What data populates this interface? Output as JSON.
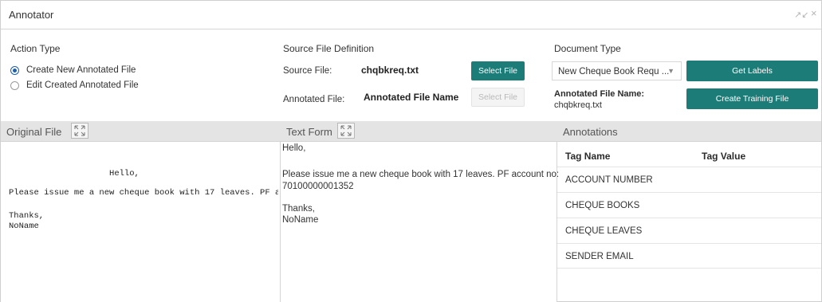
{
  "window": {
    "title": "Annotator",
    "minimize_glyph": "↗↙",
    "close_glyph": "×"
  },
  "action_type": {
    "label": "Action Type",
    "options": [
      {
        "label": "Create New Annotated File",
        "checked": true
      },
      {
        "label": "Edit Created Annotated File",
        "checked": false
      }
    ]
  },
  "source": {
    "label": "Source File Definition",
    "source_file_label": "Source File:",
    "source_file_value": "chqbkreq.txt",
    "select_file_label": "Select File",
    "annotated_file_label": "Annotated File:",
    "annotated_file_value": "Annotated File Name",
    "select_file_disabled_label": "Select File"
  },
  "document_type": {
    "label": "Document Type",
    "selected": "New Cheque Book Requ ...",
    "get_labels": "Get Labels",
    "annotated_name_label": "Annotated File Name:",
    "annotated_name_value": "chqbkreq.txt",
    "create_training": "Create Training File"
  },
  "panes": {
    "original": {
      "title": "Original File",
      "lines": [
        "                    Hello,",
        "Please issue me a new cheque book with 17 leaves. PF a",
        "",
        "Thanks,",
        "NoName"
      ]
    },
    "text_form": {
      "title": "Text Form",
      "line1": "Hello,",
      "line2": "Please issue me a new cheque book with 17 leaves. PF account no:",
      "line3": "70100000001352",
      "line4": "Thanks,",
      "line5": "NoName"
    },
    "annotations": {
      "title": "Annotations",
      "col_name": "Tag Name",
      "col_value": "Tag Value",
      "rows": [
        {
          "name": "ACCOUNT NUMBER",
          "value": ""
        },
        {
          "name": "CHEQUE BOOKS",
          "value": ""
        },
        {
          "name": "CHEQUE LEAVES",
          "value": ""
        },
        {
          "name": "SENDER EMAIL",
          "value": ""
        }
      ]
    }
  },
  "colors": {
    "accent": "#1b7c78",
    "radio": "#1d5fa8",
    "header_bg": "#e4e4e4"
  }
}
